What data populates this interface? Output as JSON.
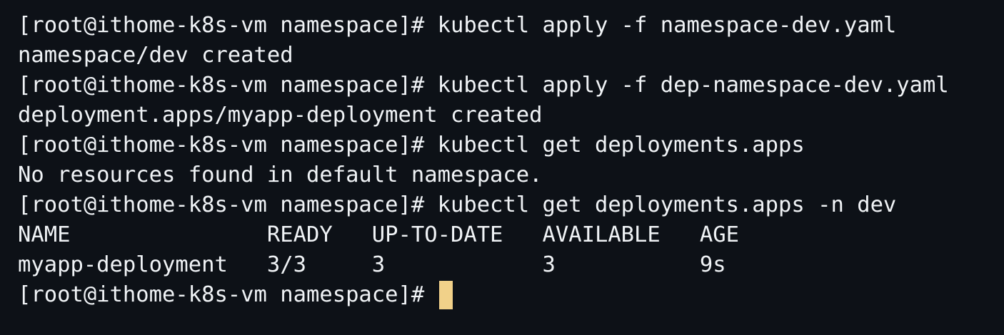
{
  "terminal": {
    "prompt": "[root@ithome-k8s-vm namespace]# ",
    "lines": [
      {
        "type": "command",
        "text": "kubectl apply -f namespace-dev.yaml"
      },
      {
        "type": "output",
        "text": "namespace/dev created"
      },
      {
        "type": "command",
        "text": "kubectl apply -f dep-namespace-dev.yaml"
      },
      {
        "type": "output",
        "text": "deployment.apps/myapp-deployment created"
      },
      {
        "type": "command",
        "text": "kubectl get deployments.apps"
      },
      {
        "type": "output",
        "text": "No resources found in default namespace."
      },
      {
        "type": "command",
        "text": "kubectl get deployments.apps -n dev"
      },
      {
        "type": "output",
        "text": "NAME               READY   UP-TO-DATE   AVAILABLE   AGE"
      },
      {
        "type": "output",
        "text": "myapp-deployment   3/3     3            3           9s"
      }
    ],
    "final_prompt": "[root@ithome-k8s-vm namespace]# "
  },
  "colors": {
    "background": "#0d1117",
    "text": "#f0f3f6",
    "cursor": "#f1d189"
  }
}
